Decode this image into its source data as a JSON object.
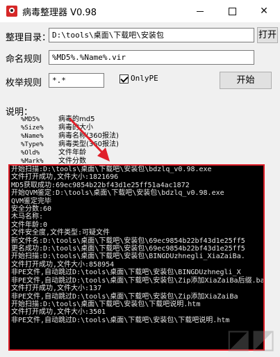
{
  "window": {
    "title": "病毒整理器 V0.98"
  },
  "form": {
    "dir_label": "整理目录：",
    "dir_value": "D:\\tools\\桌面\\下载吧\\安装包",
    "open_button": "打开",
    "name_rule_label": "命名规则",
    "name_rule_value": "%MD5%.%Name%.vir",
    "enum_rule_label": "枚举规则",
    "enum_rule_value": "*.*",
    "onlype_label": "OnlyPE",
    "onlype_checked": true,
    "start_button": "开始"
  },
  "help": {
    "title": "说明：",
    "items": [
      {
        "code": "%MD5%",
        "desc": "病毒的md5"
      },
      {
        "code": "%Size%",
        "desc": "病毒的大小"
      },
      {
        "code": "%Name%",
        "desc": "病毒名称(360报法)"
      },
      {
        "code": "%Type%",
        "desc": "病毒类型(360报法)"
      },
      {
        "code": "%Old%",
        "desc": "文件年龄"
      },
      {
        "code": "%Mark%",
        "desc": "文件分数"
      }
    ]
  },
  "console": {
    "lines": [
      "开始扫描:D:\\tools\\桌面\\下载吧\\安装包\\bdzlq_v0.98.exe",
      "文件打开成功,文件大小:1821696",
      "MD5获取成功:69ec9854b22bf43d1e25ff51a4ac1872",
      "开始QVM鉴定:D:\\tools\\桌面\\下载吧\\安装包\\bdzlq_v0.98.exe",
      "QVM鉴定完毕",
      "安全分数:60",
      "木马名称:",
      "文件年龄:0",
      "文件安全度,文件类型:可疑文件",
      "新文件名:D:\\tools\\桌面\\下载吧\\安装包\\69ec9854b22bf43d1e25ff5",
      "更名成功:D:\\tools\\桌面\\下载吧\\安装包\\69ec9854b22bf43d1e25ff5",
      "开始扫描:D:\\tools\\桌面\\下载吧\\安装包\\BINGDUzhnegli_XiaZaiBa.",
      "文件打开成功,文件大小:858954",
      "非PE文件,自动跳过D:\\tools\\桌面\\下载吧\\安装包\\BINGDUzhnegli_X",
      "非PE文件,自动跳过D:\\tools\\桌面\\下载吧\\安装包\\Zip添加XiaZaiBa后缀.bat",
      "文件打开成功,文件大小:137",
      "非PE文件,自动跳过D:\\tools\\桌面\\下载吧\\安装包\\Zip添加XiaZaiBa",
      "开始扫描:D:\\tools\\桌面\\下载吧\\安装包\\下载吧说明.htm",
      "文件打开成功,文件大小:3501",
      "非PE文件,自动跳过D:\\tools\\桌面\\下载吧\\安装包\\下载吧说明.htm"
    ]
  },
  "colors": {
    "highlight_border": "#e0202a",
    "console_bg": "#000000",
    "console_text": "#e6e6e6"
  }
}
